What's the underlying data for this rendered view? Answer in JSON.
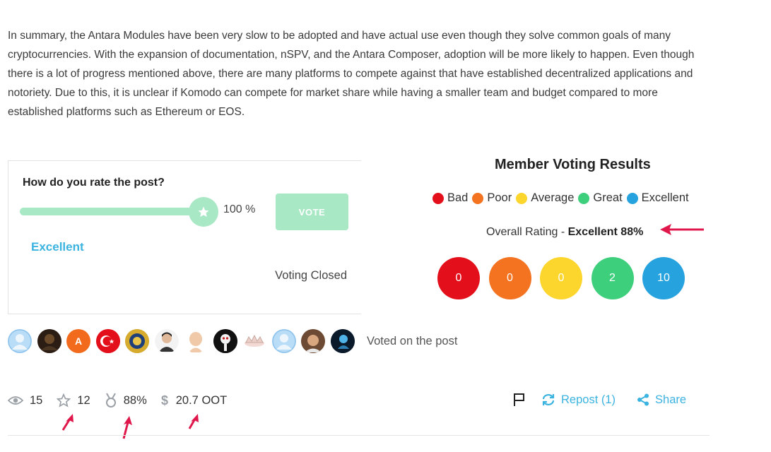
{
  "post": {
    "summary": "In summary, the Antara Modules have been very slow to be adopted and have actual use even though they solve common goals of many cryptocurrencies. With the expansion of documentation, nSPV, and the Antara Composer, adoption will be more likely to happen. Even though there is a lot of progress mentioned above, there are many platforms to compete against that have established decentralized applications and notoriety. Due to this, it is unclear if Komodo can compete for market share while having a smaller team and budget compared to more established platforms such as Ethereum or EOS."
  },
  "rating": {
    "question": "How do you rate the post?",
    "slider_value": "100 %",
    "slider_fraction": 1.0,
    "vote_label": "VOTE",
    "selected_label": "Excellent",
    "status": "Voting Closed"
  },
  "results": {
    "title": "Member Voting Results",
    "legend": [
      {
        "label": "Bad",
        "color": "#e3101c"
      },
      {
        "label": "Poor",
        "color": "#f47321"
      },
      {
        "label": "Average",
        "color": "#fcd52d"
      },
      {
        "label": "Great",
        "color": "#3ecf7d"
      },
      {
        "label": "Excellent",
        "color": "#26a3de"
      }
    ],
    "overall_prefix": "Overall Rating - ",
    "overall_value": "Excellent 88%",
    "counts": [
      "0",
      "0",
      "0",
      "2",
      "10"
    ]
  },
  "voters": {
    "label": "Voted on the post",
    "avatars": [
      "default",
      "dark",
      "A",
      "flag",
      "badge",
      "person",
      "bald",
      "mask",
      "crown",
      "default",
      "kid",
      "blue"
    ]
  },
  "stats": {
    "views": "15",
    "stars": "12",
    "score": "88%",
    "earnings": "20.7 OOT"
  },
  "actions": {
    "repost": "Repost (1)",
    "share": "Share"
  },
  "colors": {
    "accent": "#3bb3e0",
    "slider": "#a8e8c4",
    "annotation_arrow": "#e0174b"
  }
}
